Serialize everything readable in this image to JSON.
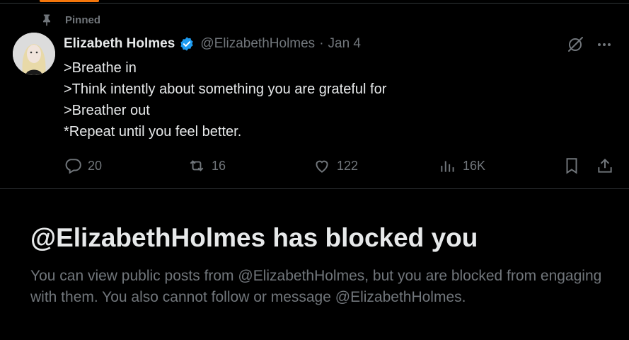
{
  "pinned": {
    "label": "Pinned",
    "icon": "pin-icon"
  },
  "tweet": {
    "author": {
      "display_name": "Elizabeth Holmes",
      "handle": "@ElizabethHolmes",
      "verified": true,
      "verified_color": "#1d9bf0"
    },
    "separator": "·",
    "date": "Jan 4",
    "lines": [
      ">Breathe in",
      ">Think intently about something you are grateful for",
      ">Breather out",
      "*Repeat until you feel better."
    ],
    "actions": {
      "replies": "20",
      "reposts": "16",
      "likes": "122",
      "views": "16K"
    }
  },
  "blocked": {
    "title": "@ElizabethHolmes has blocked you",
    "description": "You can view public posts from @ElizabethHolmes, but you are blocked from engaging with them. You also cannot follow or message @ElizabethHolmes."
  },
  "colors": {
    "background": "#000000",
    "text_primary": "#e7e9ea",
    "text_secondary": "#71767b",
    "divider": "#2f3336",
    "accent_tab": "#f4760b"
  }
}
